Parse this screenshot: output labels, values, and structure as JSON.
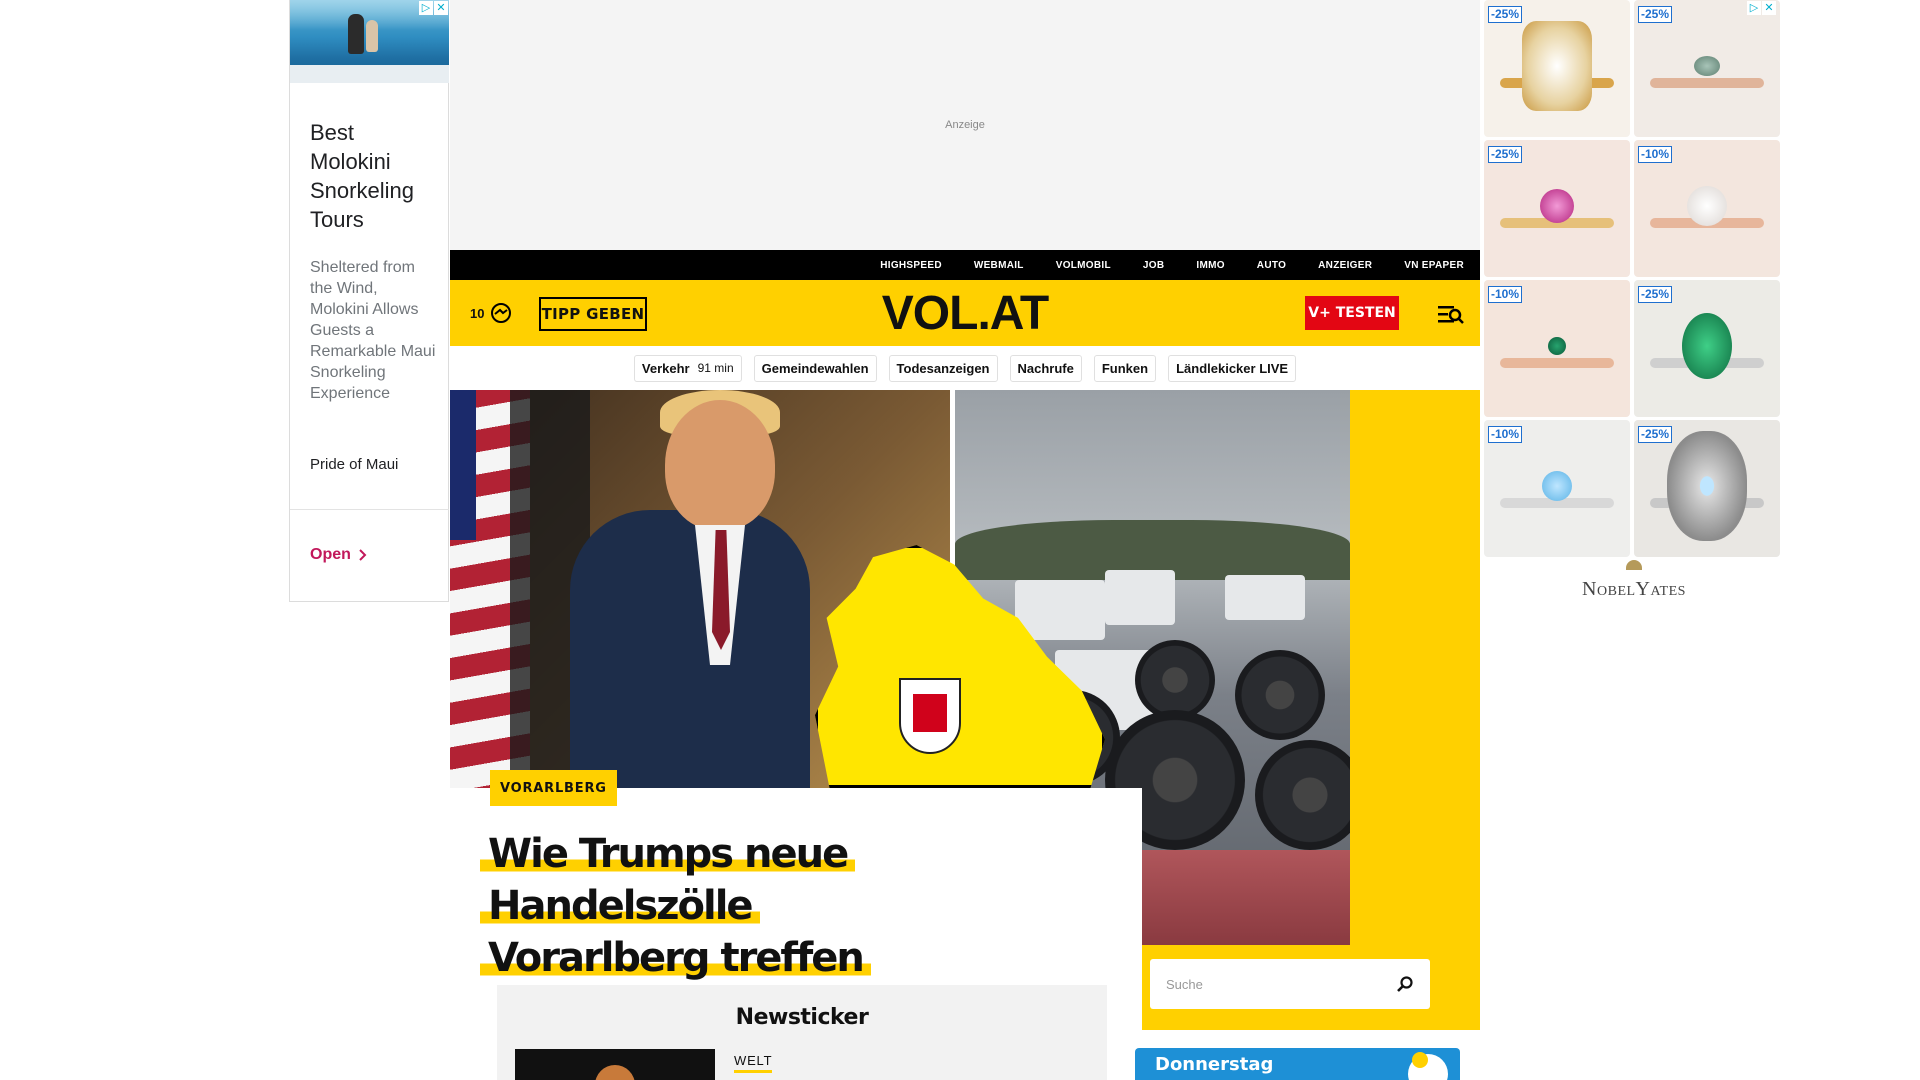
{
  "left_ad": {
    "headline": "Best Molokini Snorkeling Tours",
    "description": "Sheltered from the Wind, Molokini Allows Guests a Remarkable Maui Snorkeling Experience",
    "advertiser": "Pride of Maui",
    "cta": "Open",
    "cta_icon": "chevron-right-icon",
    "adchoices_icon": "adchoices-icon",
    "close_icon": "close-icon"
  },
  "top_ad": {
    "label": "Anzeige"
  },
  "topbar": {
    "links": [
      "HIGHSPEED",
      "WEBMAIL",
      "VOLMOBIL",
      "JOB",
      "IMMO",
      "AUTO",
      "ANZEIGER",
      "VN EPAPER"
    ]
  },
  "header": {
    "temperature": "10",
    "weather_icon": "weather-icon",
    "tipp_label": "TIPP GEBEN",
    "logo": "VOL.AT",
    "vplus_label": "V+ TESTEN",
    "menu_icon": "menu-search-icon"
  },
  "quicknav": {
    "items": [
      {
        "label": "Verkehr",
        "extra": "91 min"
      },
      {
        "label": "Gemeindewahlen"
      },
      {
        "label": "Todesanzeigen"
      },
      {
        "label": "Nachrufe"
      },
      {
        "label": "Funken"
      },
      {
        "label": "Ländlekicker LIVE"
      }
    ]
  },
  "hero": {
    "category": "VORARLBERG",
    "title_line1": "Wie Trumps neue Handelszölle",
    "title_line2": "Vorarlberg treffen"
  },
  "search": {
    "placeholder": "Suche",
    "icon": "search-icon"
  },
  "newsticker": {
    "heading": "Newsticker",
    "first_category": "WELT"
  },
  "weather_card": {
    "day": "Donnerstag"
  },
  "right_ad": {
    "badges": [
      "-25%",
      "-25%",
      "-25%",
      "-10%",
      "-10%",
      "-25%",
      "-10%",
      "-25%"
    ],
    "brand": "NobelYates",
    "adchoices_icon": "adchoices-icon",
    "close_icon": "close-icon"
  },
  "colors": {
    "brand_yellow": "#ffd000",
    "brand_red": "#e30613",
    "topbar_black": "#000000",
    "ad_cta_pink": "#c2185b",
    "badge_blue": "#1e6fcf"
  }
}
